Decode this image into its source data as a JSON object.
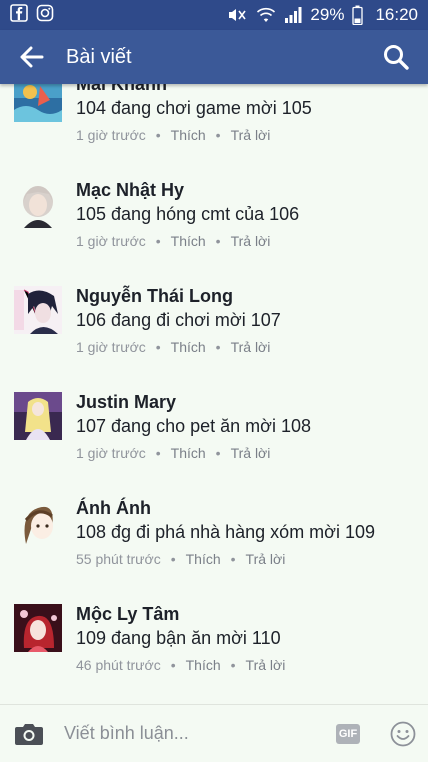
{
  "status_bar": {
    "battery": "29%",
    "time": "16:20"
  },
  "app_bar": {
    "title": "Bài viết"
  },
  "comments": [
    {
      "name": "Mai Khánh",
      "text": "104 đang chơi game mời 105",
      "time": "1 giờ trước",
      "like": "Thích",
      "reply": "Trả lời",
      "avatar_color": "#4aa0c9"
    },
    {
      "name": "Mạc Nhật Hy",
      "text": "105 đang hóng cmt của 106",
      "time": "1 giờ trước",
      "like": "Thích",
      "reply": "Trả lời",
      "avatar_color": "#d8d1cc"
    },
    {
      "name": "Nguyễn Thái Long",
      "text": "106 đang đi chơi mời 107",
      "time": "1 giờ trước",
      "like": "Thích",
      "reply": "Trả lời",
      "avatar_color": "#2a2d4a"
    },
    {
      "name": "Justin Mary",
      "text": "107 đang cho pet ăn mời 108",
      "time": "1 giờ trước",
      "like": "Thích",
      "reply": "Trả lời",
      "avatar_color": "#6b4a8c"
    },
    {
      "name": "Ánh Ánh",
      "text": "108 đg đi phá nhà hàng xóm mời 109",
      "time": "55 phút trước",
      "like": "Thích",
      "reply": "Trả lời",
      "avatar_color": "#7a5a3c"
    },
    {
      "name": "Mộc Ly Tâm",
      "text": "109 đang bận ăn mời 110",
      "time": "46 phút trước",
      "like": "Thích",
      "reply": "Trả lời",
      "avatar_color": "#b8252e"
    }
  ],
  "composer": {
    "placeholder": "Viết bình luận...",
    "gif_label": "GIF"
  },
  "icons": {
    "back": "arrow-left-icon",
    "search": "search-icon",
    "camera": "camera-icon",
    "emoji": "smiley-icon"
  }
}
